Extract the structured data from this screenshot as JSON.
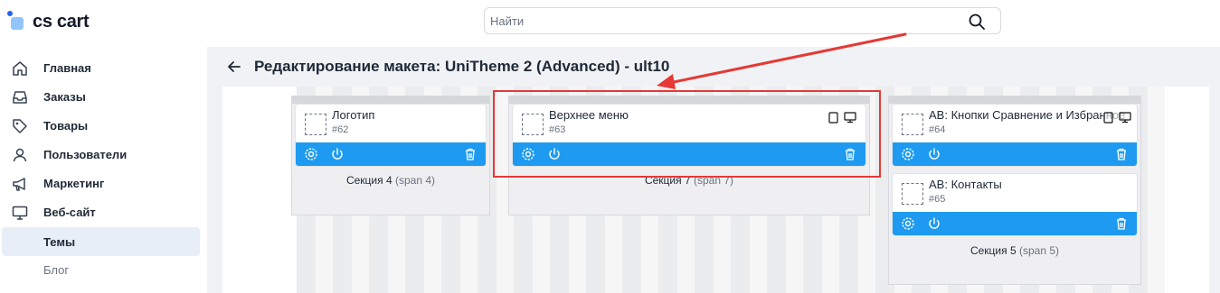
{
  "brand": {
    "logo_text": "cs cart"
  },
  "search": {
    "placeholder": "Найти",
    "value": ""
  },
  "sidebar": {
    "items": [
      {
        "label": "Главная",
        "icon": "home-icon"
      },
      {
        "label": "Заказы",
        "icon": "inbox-icon"
      },
      {
        "label": "Товары",
        "icon": "tag-icon"
      },
      {
        "label": "Пользователи",
        "icon": "user-icon"
      },
      {
        "label": "Маркетинг",
        "icon": "megaphone-icon"
      },
      {
        "label": "Веб-сайт",
        "icon": "monitor-icon"
      },
      {
        "label": "Темы",
        "active": true
      },
      {
        "label": "Блог",
        "muted": true
      }
    ]
  },
  "page": {
    "title": "Редактирование макета: UniTheme 2 (Advanced) - ult10"
  },
  "sections": [
    {
      "label": "Секция 4",
      "span": "(span 4)",
      "blocks": [
        {
          "name": "Логотип",
          "id": "#62"
        }
      ]
    },
    {
      "label": "Секция 7",
      "span": "(span 7)",
      "blocks": [
        {
          "name": "Верхнее меню",
          "id": "#63",
          "devices": [
            "tablet-icon",
            "desktop-icon"
          ]
        }
      ]
    },
    {
      "label": "Секция 5",
      "span": "(span 5)",
      "blocks": [
        {
          "name": "AB: Кнопки Сравнение и Избранное",
          "id": "#64",
          "devices": [
            "tablet-icon",
            "desktop-icon"
          ]
        },
        {
          "name": "AB: Контакты",
          "id": "#65"
        }
      ]
    }
  ],
  "colors": {
    "toolbar": "#1e9bf0",
    "highlight": "#e53935",
    "active_nav": "#e8eef7",
    "main_bg": "#f0f2f5"
  }
}
